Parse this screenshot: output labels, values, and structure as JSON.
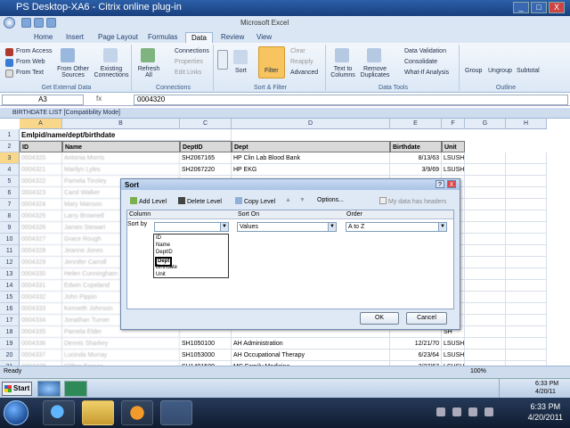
{
  "citrix": {
    "title": "PS Desktop-XA6 - Citrix online plug-in",
    "min": "_",
    "max": "□",
    "close": "X"
  },
  "excel": {
    "title": "Microsoft Excel",
    "tabs": [
      "Home",
      "Insert",
      "Page Layout",
      "Formulas",
      "Data",
      "Review",
      "View"
    ],
    "active_tab": "Data",
    "ribbon": {
      "get_external": {
        "label": "Get External Data",
        "items": [
          "From Access",
          "From Web",
          "From Text",
          "From Other Sources",
          "Existing Connections"
        ]
      },
      "connections": {
        "label": "Connections",
        "items": [
          "Refresh All",
          "Connections",
          "Properties",
          "Edit Links"
        ]
      },
      "sort_filter": {
        "label": "Sort & Filter",
        "items": [
          "Sort",
          "Filter",
          "Clear",
          "Reapply",
          "Advanced"
        ]
      },
      "data_tools": {
        "label": "Data Tools",
        "items": [
          "Text to Columns",
          "Remove Duplicates",
          "Data Validation",
          "Consolidate",
          "What-If Analysis"
        ]
      },
      "outline": {
        "label": "Outline",
        "items": [
          "Group",
          "Ungroup",
          "Subtotal"
        ]
      }
    },
    "namebox": "A3",
    "fx": "fx",
    "formula_value": "0004320",
    "workbook_title": "BIRTHDATE LIST  [Compatibility Mode]",
    "columns": [
      "A",
      "B",
      "C",
      "D",
      "E",
      "F",
      "G",
      "H"
    ],
    "header_merged": "Emlpid/name/dept/birthdate",
    "headers": [
      "ID",
      "Name",
      "DeptID",
      "Dept",
      "Birthdate",
      "Unit"
    ],
    "rows": [
      {
        "n": "3",
        "id": "0004320",
        "name": "Antonia Morris",
        "deptid": "SH2067165",
        "dept": "HP Clin Lab Blood Bank",
        "bd": "8/13/63",
        "unit": "LSUSH"
      },
      {
        "n": "4",
        "id": "0004321",
        "name": "Marilyn Lyles",
        "deptid": "SH2067220",
        "dept": "HP EKG",
        "bd": "3/9/69",
        "unit": "LSUSH"
      },
      {
        "n": "5",
        "id": "0004322",
        "name": "Pamela Tinsley",
        "deptid": "",
        "dept": "",
        "bd": "",
        "unit": "SH"
      },
      {
        "n": "6",
        "id": "0004323",
        "name": "Carol Walker",
        "deptid": "",
        "dept": "",
        "bd": "",
        "unit": "SH"
      },
      {
        "n": "7",
        "id": "0004324",
        "name": "Mary Manson",
        "deptid": "",
        "dept": "",
        "bd": "",
        "unit": "SH"
      },
      {
        "n": "8",
        "id": "0004325",
        "name": "Larry Brownell",
        "deptid": "",
        "dept": "",
        "bd": "",
        "unit": "SH"
      },
      {
        "n": "9",
        "id": "0004326",
        "name": "James Stewart",
        "deptid": "",
        "dept": "",
        "bd": "",
        "unit": "SH"
      },
      {
        "n": "10",
        "id": "0004327",
        "name": "Grace Rough",
        "deptid": "",
        "dept": "",
        "bd": "",
        "unit": "SH"
      },
      {
        "n": "11",
        "id": "0004328",
        "name": "Jeanne Jones",
        "deptid": "",
        "dept": "",
        "bd": "",
        "unit": "SH"
      },
      {
        "n": "12",
        "id": "0004329",
        "name": "Jennifer Carroll",
        "deptid": "",
        "dept": "",
        "bd": "",
        "unit": "SH"
      },
      {
        "n": "13",
        "id": "0004330",
        "name": "Helen Cunningham",
        "deptid": "",
        "dept": "",
        "bd": "",
        "unit": "SH"
      },
      {
        "n": "14",
        "id": "0004331",
        "name": "Edwin Copeland",
        "deptid": "",
        "dept": "",
        "bd": "",
        "unit": "SH"
      },
      {
        "n": "15",
        "id": "0004332",
        "name": "John Pippin",
        "deptid": "",
        "dept": "",
        "bd": "",
        "unit": "SH"
      },
      {
        "n": "16",
        "id": "0004333",
        "name": "Kenneth Johnson",
        "deptid": "",
        "dept": "",
        "bd": "",
        "unit": "SH"
      },
      {
        "n": "17",
        "id": "0004334",
        "name": "Jonathan Turner",
        "deptid": "",
        "dept": "",
        "bd": "",
        "unit": "SH"
      },
      {
        "n": "18",
        "id": "0004335",
        "name": "Pamela Elder",
        "deptid": "",
        "dept": "",
        "bd": "",
        "unit": "SH"
      },
      {
        "n": "19",
        "id": "0004336",
        "name": "Dennis Sharkey",
        "deptid": "SH1050100",
        "dept": "AH Administration",
        "bd": "12/21/70",
        "unit": "LSUSH"
      },
      {
        "n": "20",
        "id": "0004337",
        "name": "Lucinda Murray",
        "deptid": "SH1053000",
        "dept": "AH Occupational Therapy",
        "bd": "6/23/64",
        "unit": "LSUSH"
      },
      {
        "n": "21",
        "id": "0004338",
        "name": "Clifton Barnes",
        "deptid": "SH1491500",
        "dept": "MC Family Medicine",
        "bd": "2/27/67",
        "unit": "LSUSH"
      },
      {
        "n": "22",
        "id": "0004339",
        "name": "Bettye Johnson",
        "deptid": "SH1053500",
        "dept": "AH Physical Therapy",
        "bd": "5/28/64",
        "unit": "LSUSH"
      }
    ],
    "status": "Ready",
    "zoom": "100%"
  },
  "sort_dialog": {
    "title": "Sort",
    "help": "?",
    "close": "X",
    "add_level": "Add Level",
    "delete_level": "Delete Level",
    "copy_level": "Copy Level",
    "options": "Options...",
    "has_headers": "My data has headers",
    "col_header": "Column",
    "sorton_header": "Sort On",
    "order_header": "Order",
    "sort_by": "Sort by",
    "sort_on_value": "Values",
    "order_value": "A to Z",
    "dropdown_options": [
      "ID",
      "Name",
      "DeptID",
      "Dept",
      "Birthdate",
      "Unit"
    ],
    "highlighted_option": "Dept",
    "ok": "OK",
    "cancel": "Cancel"
  },
  "inner_taskbar": {
    "start": "Start",
    "time": "6:33 PM",
    "date": "4/20/11"
  },
  "win7": {
    "time": "6:33 PM",
    "date": "4/20/2011"
  }
}
